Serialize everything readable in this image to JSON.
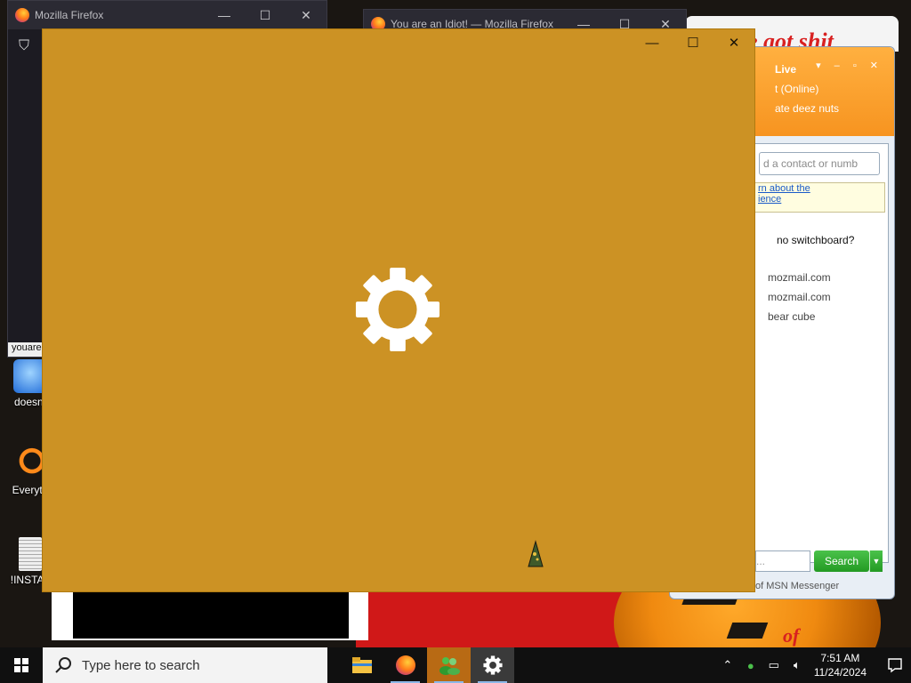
{
  "background_windows": {
    "firefox_left": {
      "title": "Mozilla Firefox",
      "tab_label": "youare"
    },
    "firefox_right": {
      "title": "You are an Idiot! — Mozilla Firefox"
    },
    "controls": {
      "minimize": "—",
      "maximize": "☐",
      "close": "✕"
    }
  },
  "wallpaper": {
    "top_text": "e got shit",
    "bottom_text": "of"
  },
  "desktop_icons": [
    {
      "label": "doesnt"
    },
    {
      "label": "Everyth"
    },
    {
      "label": "!INSTAL"
    }
  ],
  "messenger": {
    "brand": "Live",
    "status": "t  (Online)",
    "message": "ate deez nuts",
    "search_placeholder": "d a contact or numb",
    "tip_line1": "rn about the",
    "tip_line2": "ience",
    "question": "no switchboard?",
    "contacts": [
      "mozmail.com",
      "mozmail.com",
      "bear cube"
    ],
    "search_button": "Search",
    "footer": "of MSN Messenger"
  },
  "splash": {
    "controls": {
      "minimize": "—",
      "maximize": "☐",
      "close": "✕"
    },
    "icon": "gear-icon",
    "background_color": "#cc9224"
  },
  "taskbar": {
    "search_placeholder": "Type here to search",
    "apps": [
      "file-explorer-icon",
      "firefox-icon",
      "messenger-icon",
      "settings-icon"
    ],
    "clock_time": "7:51 AM",
    "clock_date": "11/24/2024"
  }
}
